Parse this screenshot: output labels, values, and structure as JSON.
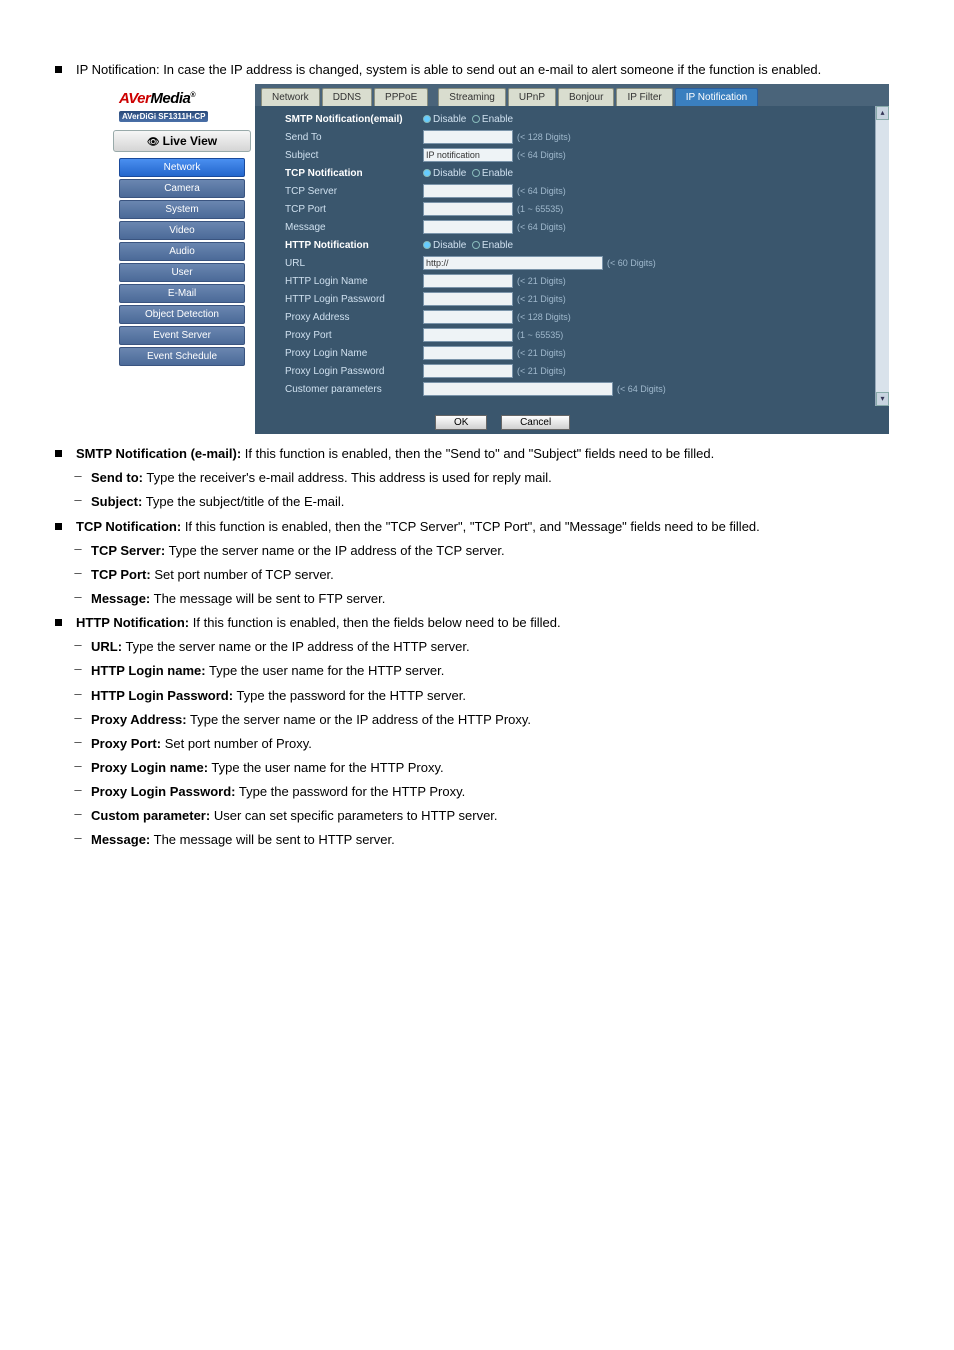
{
  "doc": {
    "intro": "IP Notification: In case the IP address is changed, system is able to send out an e-mail to alert someone if the function is enabled.",
    "smtp": {
      "heading": "SMTP Notification (e-mail):",
      "desc": "If this function is enabled, then the \"Send to\" and \"Subject\" fields need to be filled.",
      "sub1_label": "Send to:",
      "sub1_text": "Type the receiver's e-mail address. This address is used for reply mail.",
      "sub2_label": "Subject:",
      "sub2_text": "Type the subject/title of the E-mail."
    },
    "tcp": {
      "heading": "TCP Notification: ",
      "desc": "If this function is enabled, then the \"TCP Server\", \"TCP Port\", and \"Message\" fields need to be filled.",
      "sub1_label": "TCP Server:",
      "sub1_text": "Type the server name or the IP address of the TCP server.",
      "sub2_label": "TCP Port:",
      "sub2_text": "Set port number of TCP server.",
      "sub3_label": "Message:",
      "sub3_text": "The message will be sent to FTP server."
    },
    "http": {
      "heading": "HTTP Notification: ",
      "desc": "If this function is enabled, then the fields below need to be filled.",
      "sub1_label": "URL:",
      "sub1_text": "Type the server name or the IP address of the HTTP server.",
      "sub2_label": "HTTP Login name:",
      "sub2_text": "Type the user name for the HTTP server.",
      "sub3_label": "HTTP Login Password:",
      "sub3_text": "Type the password for the HTTP server.",
      "sub4_label": "Proxy Address:",
      "sub4_text": "Type the server name or the IP address of the HTTP Proxy.",
      "sub5_label": "Proxy Port:",
      "sub5_text": "Set port number of Proxy.",
      "sub6_label": "Proxy Login name:",
      "sub6_text": "Type the user name for the HTTP Proxy.",
      "sub7_label": "Proxy Login Password:",
      "sub7_text": "Type the password for the HTTP Proxy.",
      "sub8_label": "Custom parameter:",
      "sub8_text": "User can set specific parameters to HTTP server.",
      "sub9_label": "Message:",
      "sub9_text": "The message will be sent to HTTP server."
    }
  },
  "shot": {
    "logo_model": "AVerDiGi SF1311H-CP",
    "live_view": "Live View",
    "nav": [
      "Network",
      "Camera",
      "System",
      "Video",
      "Audio",
      "User",
      "E-Mail",
      "Object Detection",
      "Event Server",
      "Event Schedule"
    ],
    "tabs": [
      "Network",
      "DDNS",
      "PPPoE",
      "Streaming",
      "UPnP",
      "Bonjour",
      "IP Filter",
      "IP Notification"
    ],
    "radio_disable": "Disable",
    "radio_enable": "Enable",
    "smtp_head": "SMTP Notification(email)",
    "sendto": "Send To",
    "sendto_hint": "(< 128 Digits)",
    "subject": "Subject",
    "subject_value": "IP notification",
    "subject_hint": "(< 64 Digits)",
    "tcp_head": "TCP Notification",
    "tcp_server": "TCP Server",
    "tcp_server_hint": "(< 64 Digits)",
    "tcp_port": "TCP Port",
    "tcp_port_hint": "(1 ~ 65535)",
    "message": "Message",
    "message_hint": "(< 64 Digits)",
    "http_head": "HTTP Notification",
    "url": "URL",
    "url_value": "http://",
    "url_hint": "(< 60 Digits)",
    "http_login_name": "HTTP Login Name",
    "http_login_name_hint": "(< 21 Digits)",
    "http_login_pw": "HTTP Login Password",
    "http_login_pw_hint": "(< 21 Digits)",
    "proxy_addr": "Proxy Address",
    "proxy_addr_hint": "(< 128 Digits)",
    "proxy_port": "Proxy Port",
    "proxy_port_hint": "(1 ~ 65535)",
    "proxy_login_name": "Proxy Login Name",
    "proxy_login_name_hint": "(< 21 Digits)",
    "proxy_login_pw": "Proxy Login Password",
    "proxy_login_pw_hint": "(< 21 Digits)",
    "cust_params": "Customer parameters",
    "cust_params_hint": "(< 64 Digits)",
    "ok": "OK",
    "cancel": "Cancel"
  }
}
